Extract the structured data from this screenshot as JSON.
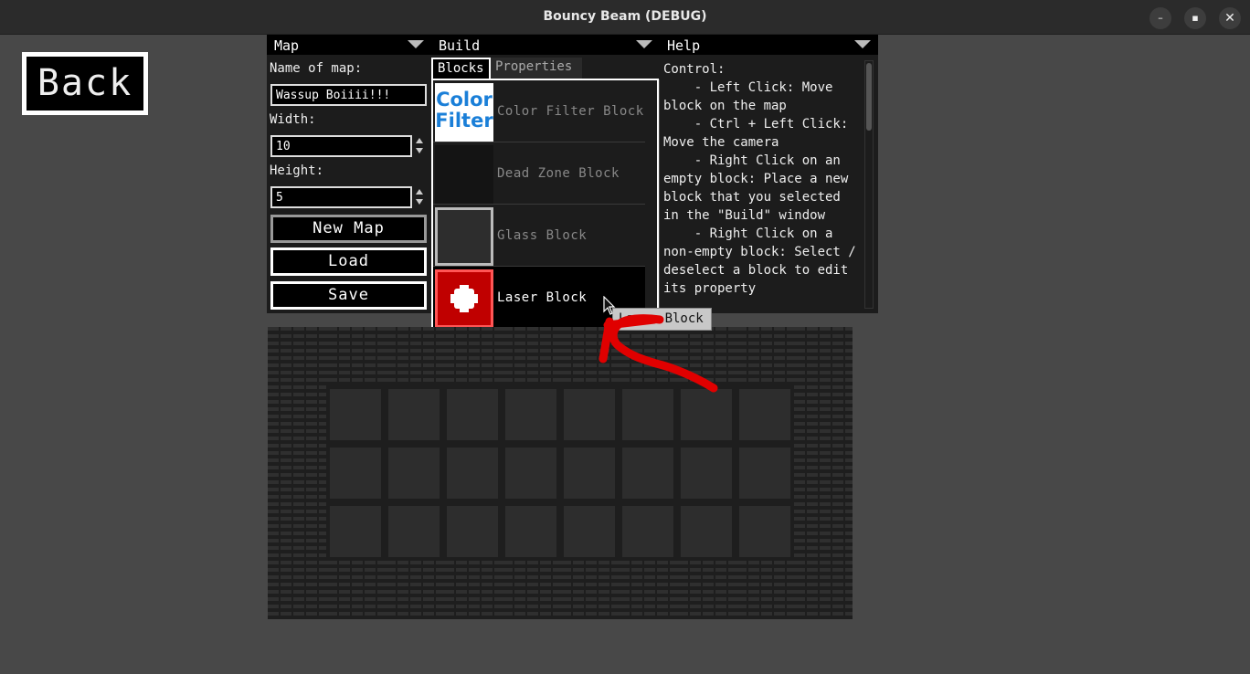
{
  "window": {
    "title": "Bouncy Beam (DEBUG)",
    "minimize_glyph": "–",
    "maximize_glyph": "▪",
    "close_glyph": "✕"
  },
  "back_button": {
    "label": "Back"
  },
  "map_panel": {
    "title": "Map",
    "name_label": "Name of map:",
    "name_value": "Wassup Boiiii!!!",
    "width_label": "Width:",
    "width_value": "10",
    "height_label": "Height:",
    "height_value": "5",
    "new_map_label": "New Map",
    "load_label": "Load",
    "save_label": "Save"
  },
  "build_panel": {
    "title": "Build",
    "tabs": [
      {
        "label": "Blocks",
        "active": true
      },
      {
        "label": "Properties",
        "active": false
      }
    ],
    "blocks": [
      {
        "name": "Color Filter Block",
        "icon": "color-filter-thumb",
        "thumb_text": "Color Filter"
      },
      {
        "name": "Dead Zone Block",
        "icon": "dead-zone-thumb"
      },
      {
        "name": "Glass Block",
        "icon": "glass-thumb"
      },
      {
        "name": "Laser Block",
        "icon": "laser-thumb",
        "selected": true
      },
      {
        "name": "",
        "icon": "brick-thumb"
      }
    ]
  },
  "help_panel": {
    "title": "Help",
    "text": "Control:\n    - Left Click: Move block on the map\n    - Ctrl + Left Click: Move the camera\n    - Right Click on an empty block: Place a new block that you selected in the \"Build\" window\n    - Right Click on a non-empty block: Select / deselect a block to edit its property"
  },
  "tooltip": {
    "text": "Laser Block"
  },
  "colors": {
    "background": "#484848",
    "panel": "#1c1c1c",
    "accent_red": "#e00000",
    "color_filter_blue": "#1a7fd8"
  }
}
